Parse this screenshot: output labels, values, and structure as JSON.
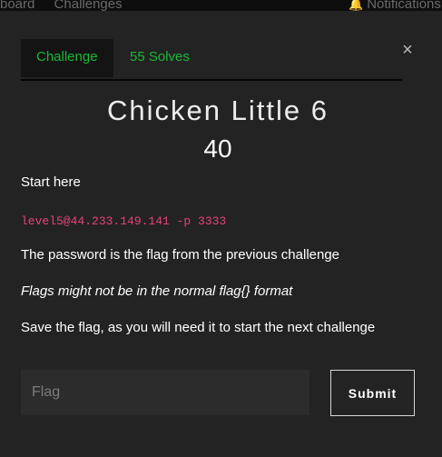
{
  "nav": {
    "items": [
      "board",
      "Challenges"
    ],
    "notifications_label": "Notifications"
  },
  "tabs": [
    {
      "label": "Challenge"
    },
    {
      "label": "55 Solves"
    }
  ],
  "close_symbol": "×",
  "challenge": {
    "title": "Chicken Little 6",
    "points": "40",
    "description": {
      "line1": "Start here",
      "command": "level5@44.233.149.141 -p 3333",
      "line3": "The password is the flag from the previous challenge",
      "note": "Flags might not be in the normal flag{} format",
      "line5": "Save the flag, as you will need it to start the next challenge"
    }
  },
  "form": {
    "flag_placeholder": "Flag",
    "submit_label": "Submit"
  },
  "colors": {
    "tab_text": "#19b934",
    "command_text": "#e8427a",
    "modal_bg": "#232323"
  }
}
